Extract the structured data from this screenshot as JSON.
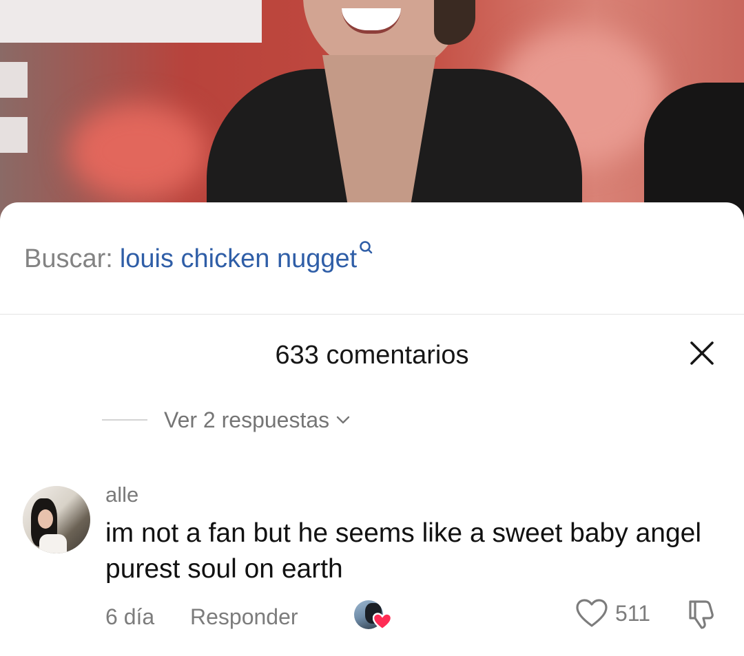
{
  "search": {
    "prefix": "Buscar:",
    "query": "louis chicken nugget"
  },
  "comments": {
    "title": "633 comentarios",
    "view_replies_label": "Ver 2 respuestas"
  },
  "comment": {
    "username": "alle",
    "text": "im not a fan but he seems like a sweet baby angel purest soul on earth",
    "time": "6 día",
    "reply_label": "Responder",
    "like_count": "511"
  },
  "icons": {
    "search": "search-icon",
    "close": "close-icon",
    "chevron": "chevron-down-icon",
    "like": "heart-icon",
    "creator_liked": "heart-badge-icon",
    "dislike": "dislike-icon"
  },
  "colors": {
    "search_link": "#2f5ea7",
    "heart_badge": "#fe2c55",
    "muted_text": "#7c7c7c"
  }
}
